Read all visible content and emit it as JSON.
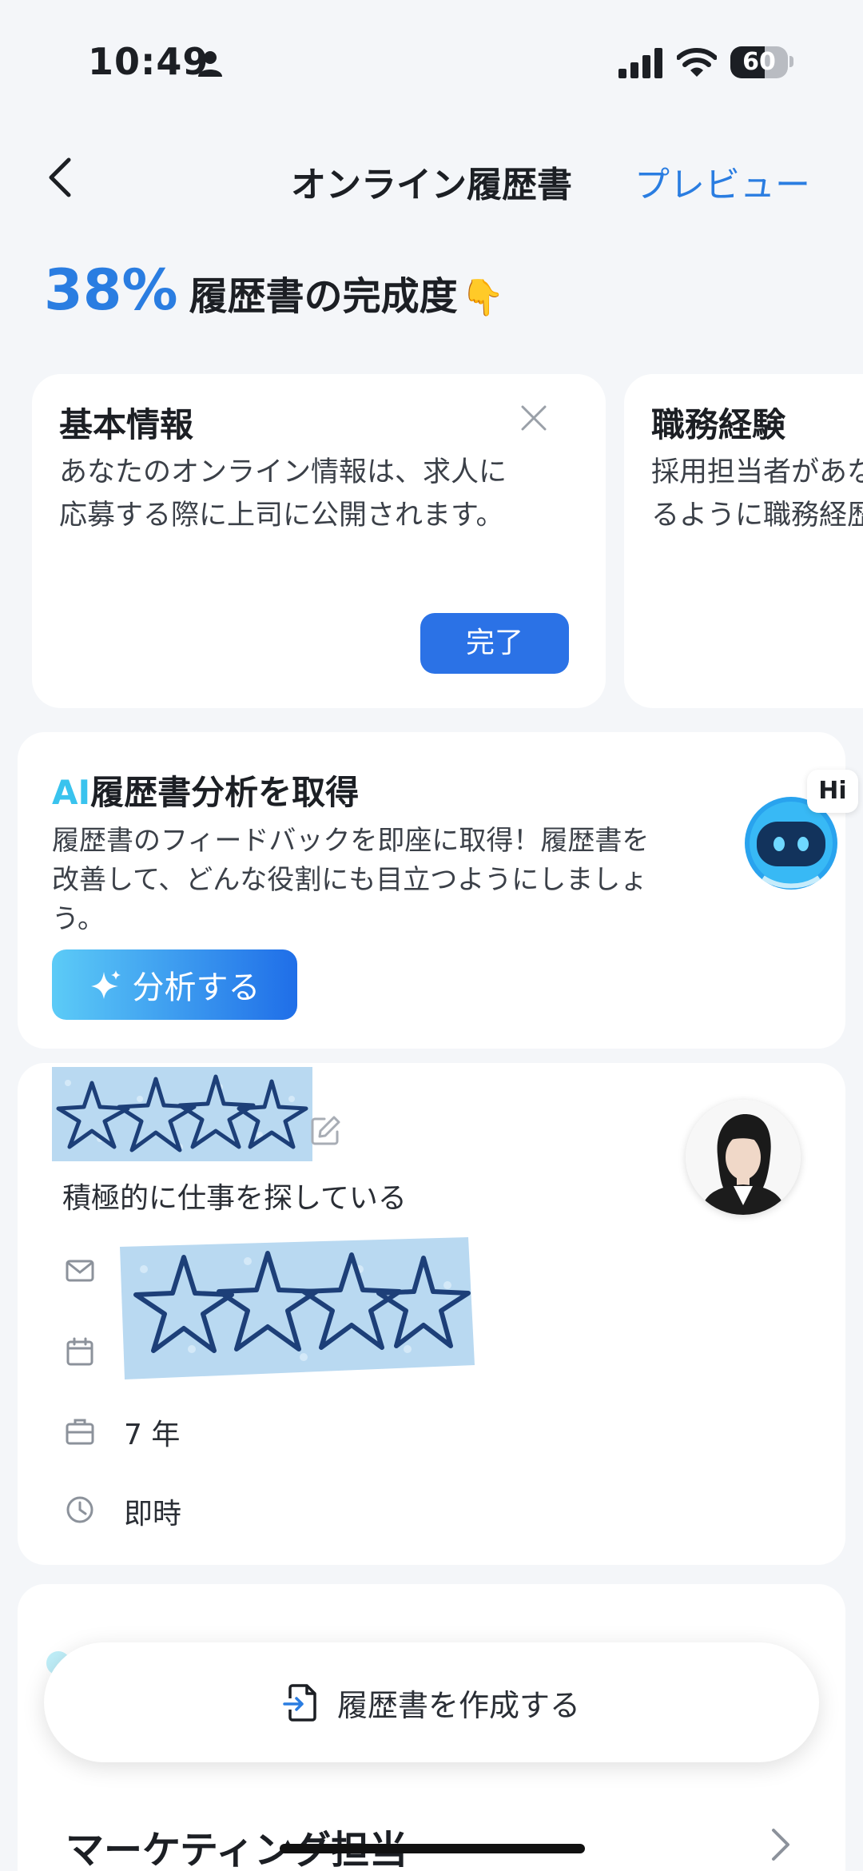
{
  "status_bar": {
    "time": "10:49",
    "battery_level": "60",
    "battery_fraction": 0.6
  },
  "nav": {
    "title": "オンライン履歴書",
    "preview_label": "プレビュー"
  },
  "completeness": {
    "percent": "38%",
    "label": "履歴書の完成度",
    "icon": "pointing-down-icon"
  },
  "task_cards": [
    {
      "title": "基本情報",
      "description": "あなたのオンライン情報は、求人に\n応募する際に上司に公開されます。",
      "button_label": "完了"
    },
    {
      "title": "職務経験",
      "description": "採用担当者があな\nるように職務経歴"
    }
  ],
  "ai_card": {
    "title_prefix": "AI",
    "title": "履歴書分析を取得",
    "description": "履歴書のフィードバックを即座に取得！履歴書を\n改善して、どんな役割にも目立つようにしましょ\nう。",
    "button_label": "分析する",
    "bubble": "Hi"
  },
  "profile": {
    "job_status": "積極的に仕事を探している",
    "experience": "7 年",
    "availability": "即時"
  },
  "bottom": {
    "create_label": "履歴書を作成する",
    "job_title": "マーケティング担当"
  },
  "colors": {
    "accent": "#2a7de1",
    "button": "#2b72e6",
    "ai_cyan": "#39c3ee"
  }
}
